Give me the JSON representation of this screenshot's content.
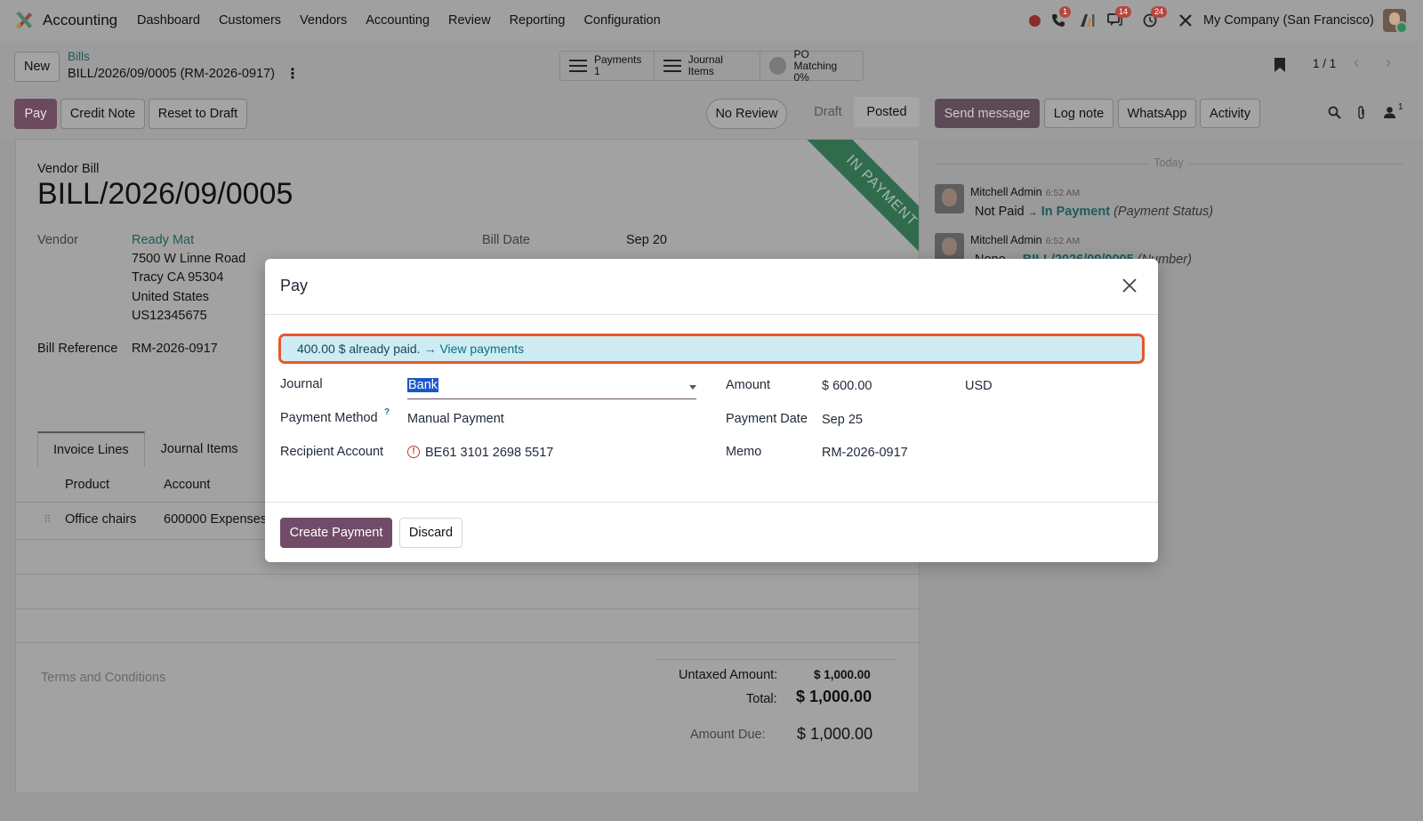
{
  "navbar": {
    "app_name": "Accounting",
    "menu": [
      "Dashboard",
      "Customers",
      "Vendors",
      "Accounting",
      "Review",
      "Reporting",
      "Configuration"
    ],
    "badges": {
      "calls": "1",
      "messages": "14",
      "activities": "24"
    },
    "company": "My Company (San Francisco)",
    "icons": [
      "status-dot-icon",
      "phone-icon",
      "ai-icon",
      "chat-icon",
      "clock-icon",
      "tools-icon"
    ]
  },
  "control_panel": {
    "new_label": "New",
    "breadcrumb_parent": "Bills",
    "breadcrumb_current": "BILL/2026/09/0005 (RM-2026-0917)",
    "smart_buttons": {
      "payments_label": "Payments",
      "payments_count": "1",
      "journal_items_label": "Journal Items",
      "po_matching_label": "PO Matching",
      "po_matching_value": "0%"
    },
    "pager": "1 / 1",
    "actions": {
      "pay": "Pay",
      "credit_note": "Credit Note",
      "reset_to_draft": "Reset to Draft",
      "no_review": "No Review"
    },
    "status": {
      "draft": "Draft",
      "posted": "Posted"
    }
  },
  "sheet": {
    "ribbon": "IN PAYMENT",
    "doc_type": "Vendor Bill",
    "doc_name": "BILL/2026/09/0005",
    "vendor_label": "Vendor",
    "vendor_name": "Ready Mat",
    "vendor_address": [
      "7500 W Linne Road",
      "Tracy CA 95304",
      "United States",
      "US12345675"
    ],
    "bill_date_label": "Bill Date",
    "bill_date": "Sep 20",
    "bill_ref_label": "Bill Reference",
    "bill_ref": "RM-2026-0917",
    "tabs": [
      "Invoice Lines",
      "Journal Items"
    ],
    "columns": [
      "Product",
      "Account"
    ],
    "lines": [
      {
        "product": "Office chairs",
        "account": "600000 Expenses"
      }
    ],
    "terms": "Terms and Conditions",
    "totals": {
      "untaxed_label": "Untaxed Amount:",
      "untaxed": "$ 1,000.00",
      "total_label": "Total:",
      "total": "$ 1,000.00",
      "due_label": "Amount Due:",
      "due": "$ 1,000.00"
    }
  },
  "chatter": {
    "buttons": {
      "send_message": "Send message",
      "log_note": "Log note",
      "whatsapp": "WhatsApp",
      "activity": "Activity"
    },
    "followers_count": "1",
    "today": "Today",
    "messages": [
      {
        "author": "Mitchell Admin",
        "time": "6:52 AM",
        "old": "Not Paid",
        "arrow": "→",
        "new": "In Payment",
        "field": "(Payment Status)"
      },
      {
        "author": "Mitchell Admin",
        "time": "6:52 AM",
        "old": "None",
        "arrow": "→",
        "new": "BILL/2026/09/0005",
        "field": "(Number)"
      }
    ]
  },
  "dialog": {
    "title": "Pay",
    "alert_text": "400.00 $ already paid.",
    "alert_arrow": "→",
    "alert_link": "View payments",
    "journal_label": "Journal",
    "journal_value": "Bank",
    "payment_method_label": "Payment Method",
    "payment_method_help": "?",
    "payment_method_value": "Manual Payment",
    "recipient_label": "Recipient Account",
    "recipient_value": "BE61 3101 2698 5517",
    "amount_label": "Amount",
    "amount_value": "$ 600.00",
    "currency": "USD",
    "payment_date_label": "Payment Date",
    "payment_date_value": "Sep 25",
    "memo_label": "Memo",
    "memo_value": "RM-2026-0917",
    "create_label": "Create Payment",
    "discard_label": "Discard"
  }
}
